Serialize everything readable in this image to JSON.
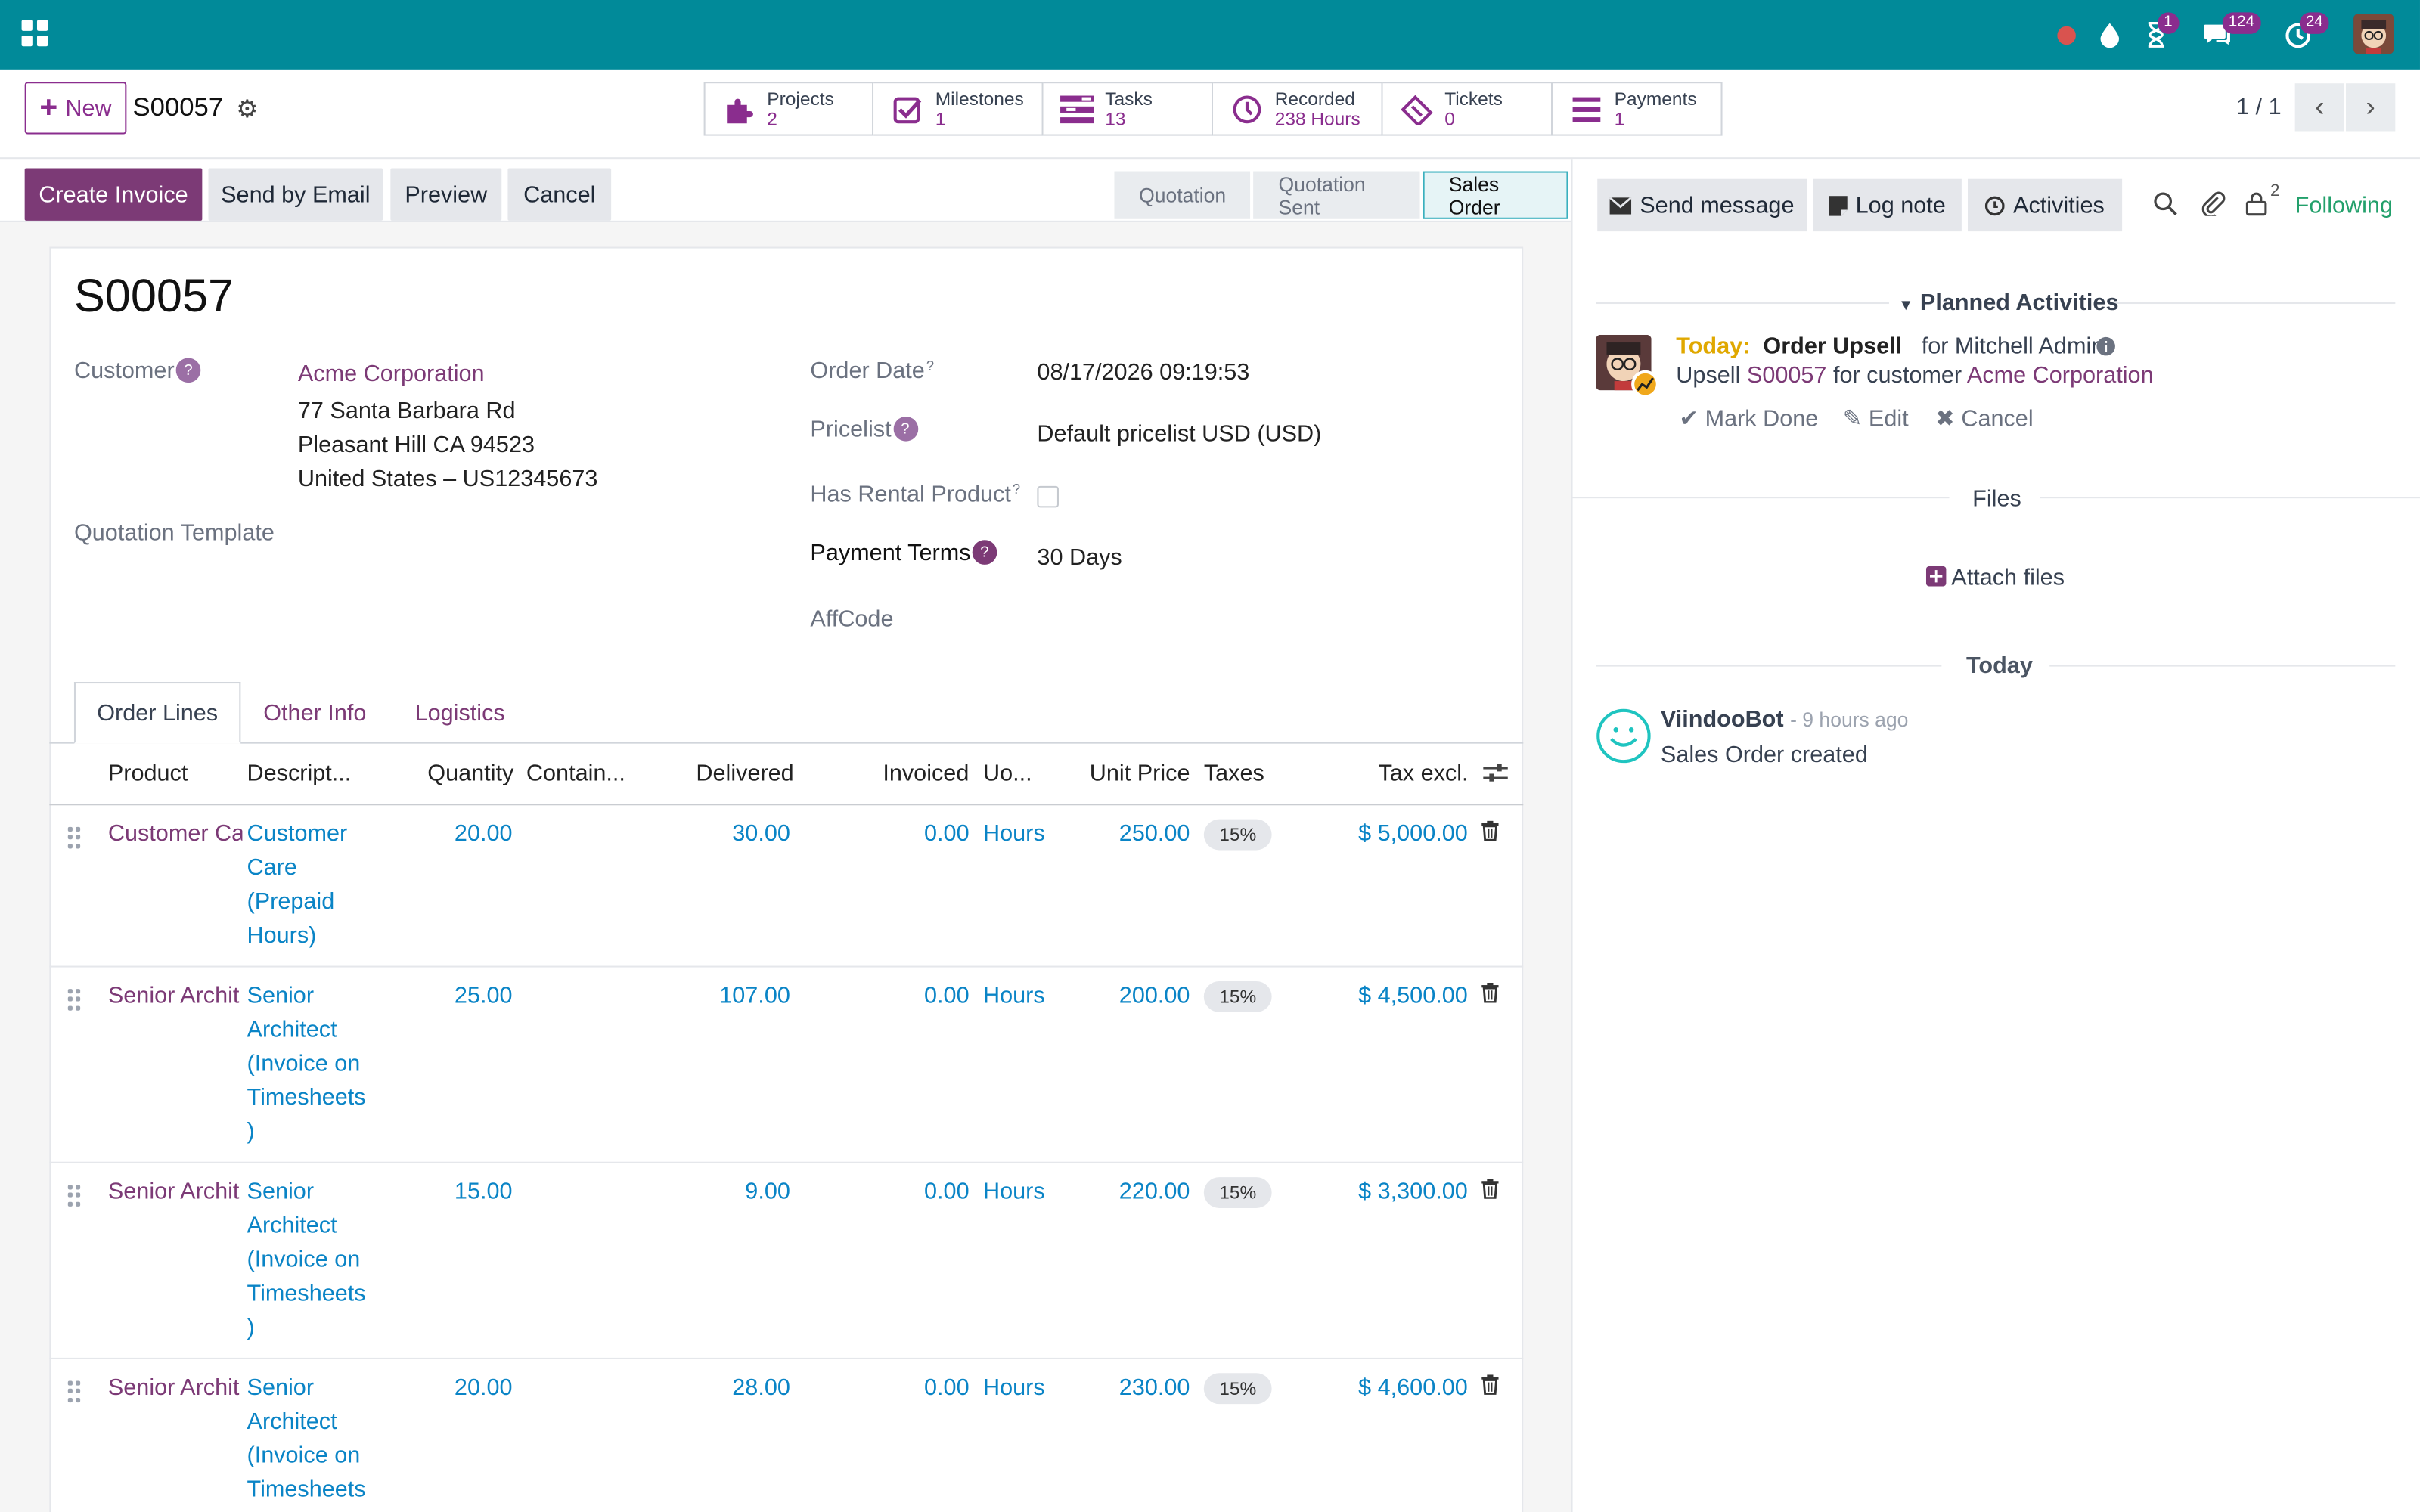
{
  "topbar": {
    "messages_count": "124",
    "activities_count": "24",
    "timer_count": "1"
  },
  "control": {
    "new_label": "New",
    "record_name": "S00057",
    "pager": "1 / 1",
    "smart_buttons": [
      {
        "label": "Projects",
        "value": "2",
        "icon": "puzzle-icon"
      },
      {
        "label": "Milestones",
        "value": "1",
        "icon": "check-square-icon"
      },
      {
        "label": "Tasks",
        "value": "13",
        "icon": "tasks-icon"
      },
      {
        "label": "Recorded",
        "value": "238 Hours",
        "icon": "clock-icon"
      },
      {
        "label": "Tickets",
        "value": "0",
        "icon": "ticket-icon"
      },
      {
        "label": "Payments",
        "value": "1",
        "icon": "menu-icon"
      }
    ]
  },
  "actions": {
    "create_invoice": "Create Invoice",
    "send_email": "Send by Email",
    "preview": "Preview",
    "cancel": "Cancel"
  },
  "stages": [
    "Quotation",
    "Quotation Sent",
    "Sales Order"
  ],
  "form": {
    "title": "S00057",
    "customer_label": "Customer",
    "customer_name": "Acme Corporation",
    "address_1": "77 Santa Barbara Rd",
    "address_2": "Pleasant Hill CA 94523",
    "address_3": "United States – US12345673",
    "quotation_template_label": "Quotation Template",
    "order_date_label": "Order Date",
    "order_date": "08/17/2026 09:19:53",
    "pricelist_label": "Pricelist",
    "pricelist": "Default pricelist USD (USD)",
    "rental_label": "Has Rental Product",
    "payment_terms_label": "Payment Terms",
    "payment_terms": "30 Days",
    "affcode_label": "AffCode"
  },
  "tabs": [
    "Order Lines",
    "Other Info",
    "Logistics"
  ],
  "table": {
    "headers": [
      "Product",
      "Descript...",
      "Quantity",
      "Contain...",
      "Delivered",
      "Invoiced",
      "Uo...",
      "Unit Price",
      "Taxes",
      "Tax excl."
    ],
    "rows": [
      {
        "product": "Customer Ca",
        "desc": [
          "Customer",
          "Care",
          "(Prepaid",
          "Hours)"
        ],
        "qty": "20.00",
        "delivered": "30.00",
        "invoiced": "0.00",
        "uom": "Hours",
        "price": "250.00",
        "tax": "15%",
        "total": "$ 5,000.00"
      },
      {
        "product": "Senior Archit",
        "desc": [
          "Senior",
          "Architect",
          "(Invoice on",
          "Timesheets",
          ")"
        ],
        "qty": "25.00",
        "delivered": "107.00",
        "invoiced": "0.00",
        "uom": "Hours",
        "price": "200.00",
        "tax": "15%",
        "total": "$ 4,500.00"
      },
      {
        "product": "Senior Archit",
        "desc": [
          "Senior",
          "Architect",
          "(Invoice on",
          "Timesheets",
          ")"
        ],
        "qty": "15.00",
        "delivered": "9.00",
        "invoiced": "0.00",
        "uom": "Hours",
        "price": "220.00",
        "tax": "15%",
        "total": "$ 3,300.00"
      },
      {
        "product": "Senior Archit",
        "desc": [
          "Senior",
          "Architect",
          "(Invoice on",
          "Timesheets"
        ],
        "qty": "20.00",
        "delivered": "28.00",
        "invoiced": "0.00",
        "uom": "Hours",
        "price": "230.00",
        "tax": "15%",
        "total": "$ 4,600.00"
      }
    ]
  },
  "chatter": {
    "send_message": "Send message",
    "log_note": "Log note",
    "activities": "Activities",
    "followers_count": "2",
    "following": "Following",
    "planned_title": "Planned Activities",
    "activity_today": "Today:",
    "activity_name": "Order Upsell",
    "activity_for": "for Mitchell Admin",
    "activity_desc_pre": "Upsell",
    "activity_desc_order": "S00057",
    "activity_desc_mid": "for customer",
    "activity_desc_customer": "Acme Corporation",
    "mark_done": "Mark Done",
    "edit": "Edit",
    "cancel": "Cancel",
    "files_title": "Files",
    "attach_files": "Attach files",
    "today_title": "Today",
    "bot_name": "ViindooBot",
    "bot_time": "- 9 hours ago",
    "bot_message": "Sales Order created"
  }
}
